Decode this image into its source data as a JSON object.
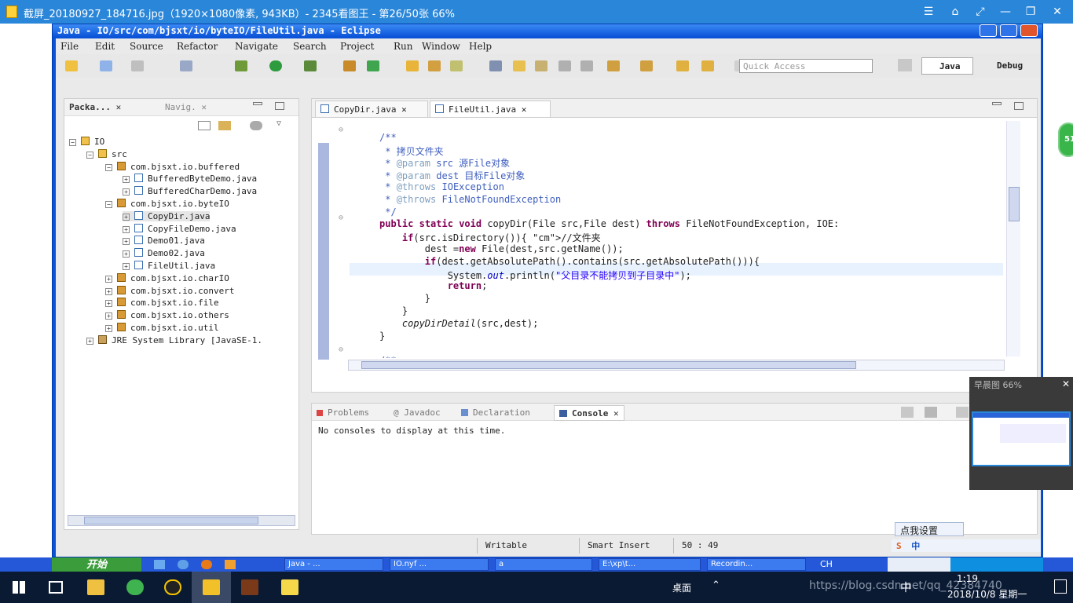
{
  "viewer": {
    "title": "截屏_20180927_184716.jpg（1920×1080像素, 943KB）- 2345看图王 - 第26/50张 66%",
    "controls": [
      "☰",
      "⌂",
      "⤢",
      "—",
      "❐",
      "✕"
    ]
  },
  "eclipse": {
    "title": "Java - IO/src/com/bjsxt/io/byteIO/FileUtil.java - Eclipse",
    "menu": [
      "File",
      "Edit",
      "Source",
      "Refactor",
      "Navigate",
      "Search",
      "Project",
      "Run",
      "Window",
      "Help"
    ],
    "quick_access": "Quick Access",
    "perspectives": [
      "Java",
      "Debug"
    ]
  },
  "package_explorer": {
    "tabs": [
      "Packa...",
      "Navig."
    ],
    "tree": [
      {
        "label": "IO",
        "kind": "proj",
        "exp": "−"
      },
      {
        "label": "src",
        "kind": "proj",
        "exp": "−"
      },
      {
        "label": "com.bjsxt.io.buffered",
        "kind": "pkg",
        "exp": "−"
      },
      {
        "label": "BufferedByteDemo.java",
        "kind": "java",
        "exp": "+"
      },
      {
        "label": "BufferedCharDemo.java",
        "kind": "java",
        "exp": "+"
      },
      {
        "label": "com.bjsxt.io.byteIO",
        "kind": "pkg",
        "exp": "−"
      },
      {
        "label": "CopyDir.java",
        "kind": "java",
        "exp": "+"
      },
      {
        "label": "CopyFileDemo.java",
        "kind": "java",
        "exp": "+"
      },
      {
        "label": "Demo01.java",
        "kind": "java",
        "exp": "+"
      },
      {
        "label": "Demo02.java",
        "kind": "java",
        "exp": "+"
      },
      {
        "label": "FileUtil.java",
        "kind": "java",
        "exp": "+"
      },
      {
        "label": "com.bjsxt.io.charIO",
        "kind": "pkg",
        "exp": "+"
      },
      {
        "label": "com.bjsxt.io.convert",
        "kind": "pkg",
        "exp": "+"
      },
      {
        "label": "com.bjsxt.io.file",
        "kind": "pkg",
        "exp": "+"
      },
      {
        "label": "com.bjsxt.io.others",
        "kind": "pkg",
        "exp": "+"
      },
      {
        "label": "com.bjsxt.io.util",
        "kind": "pkg",
        "exp": "+"
      },
      {
        "label": "JRE System Library [JavaSE-1.",
        "kind": "lib",
        "exp": "+"
      }
    ]
  },
  "editor": {
    "tabs": [
      "CopyDir.java",
      "FileUtil.java"
    ],
    "lines": [
      "",
      "/**",
      " * 拷贝文件夹",
      " * @param src 源File对象",
      " * @param dest 目标File对象",
      " * @throws IOException",
      " * @throws FileNotFoundException",
      " */",
      "public static void copyDir(File src,File dest) throws FileNotFoundException, IOE:",
      "    if(src.isDirectory()){ //文件夹",
      "        dest =new File(dest,src.getName());",
      "        if(dest.getAbsolutePath().contains(src.getAbsolutePath())){",
      "            System.out.println(\"父目录不能拷贝到子目录中\");",
      "            return;",
      "        }",
      "    }",
      "    copyDirDetail(src,dest);",
      "}",
      "",
      "/**"
    ]
  },
  "bottom": {
    "tabs": [
      "Problems",
      "Javadoc",
      "Declaration",
      "Console"
    ],
    "console_text": "No consoles to display at this time."
  },
  "status": {
    "writable": "Writable",
    "insert": "Smart Insert",
    "position": "50 : 49"
  },
  "ime_hint": "点我设置",
  "xp_taskbar": {
    "start": "开始",
    "items": [
      "Java - ...",
      "IO.nyf ...",
      "a",
      "E:\\xp\\t...",
      "Recordin..."
    ],
    "lang": "CH"
  },
  "thumbnail_label": "早晨图 66%",
  "windows_tray": {
    "desktop": "桌面",
    "time": "1:19",
    "date": "2018/10/8 星期一",
    "ime": "中",
    "watermark": "https://blog.csdn.net/qq_42384740"
  },
  "badge": "51"
}
